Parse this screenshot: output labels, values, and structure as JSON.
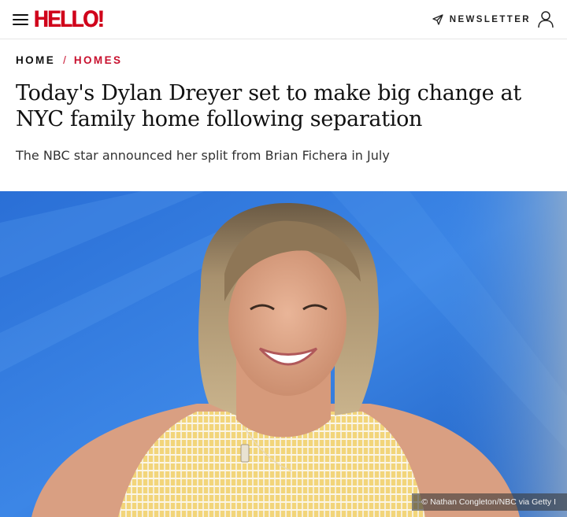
{
  "header": {
    "logo_text": "HELLO!",
    "newsletter_label": "NEWSLETTER",
    "icons": {
      "menu": "hamburger-menu-icon",
      "newsletter": "send-icon",
      "account": "user-icon"
    },
    "colors": {
      "brand": "#d0021b"
    }
  },
  "breadcrumb": {
    "home": "HOME",
    "separator": "/",
    "current": "HOMES",
    "accent_color": "#c8102e"
  },
  "article": {
    "headline": "Today's Dylan Dreyer set to make big change at NYC family home following separation",
    "subheadline": "The NBC star announced her split from Brian Fichera in July",
    "image_credit": "© Nathan Congleton/NBC via Getty I"
  }
}
